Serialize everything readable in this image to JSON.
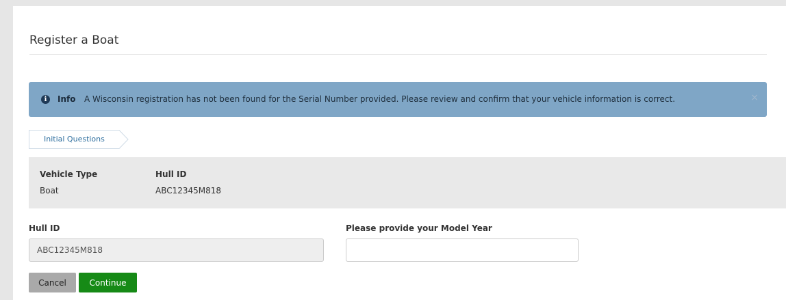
{
  "page": {
    "title": "Register a Boat"
  },
  "alert": {
    "icon": "info-icon",
    "icon_glyph": "i",
    "label": "Info",
    "message": "A Wisconsin registration has not been found for the Serial Number provided. Please review and confirm that your vehicle information is correct.",
    "close_glyph": "×",
    "background_color": "#7fa6c6"
  },
  "steps": [
    {
      "label": "Initial Questions",
      "state": "current"
    }
  ],
  "summary": {
    "vehicle_type_label": "Vehicle Type",
    "vehicle_type_value": "Boat",
    "hull_id_label": "Hull ID",
    "hull_id_value": "ABC12345M818"
  },
  "form": {
    "hull_id": {
      "label": "Hull ID",
      "value": "ABC12345M818",
      "readonly": true
    },
    "model_year": {
      "label": "Please provide your Model Year",
      "value": "",
      "placeholder": ""
    }
  },
  "actions": {
    "cancel_label": "Cancel",
    "continue_label": "Continue",
    "continue_color": "#168a16"
  }
}
